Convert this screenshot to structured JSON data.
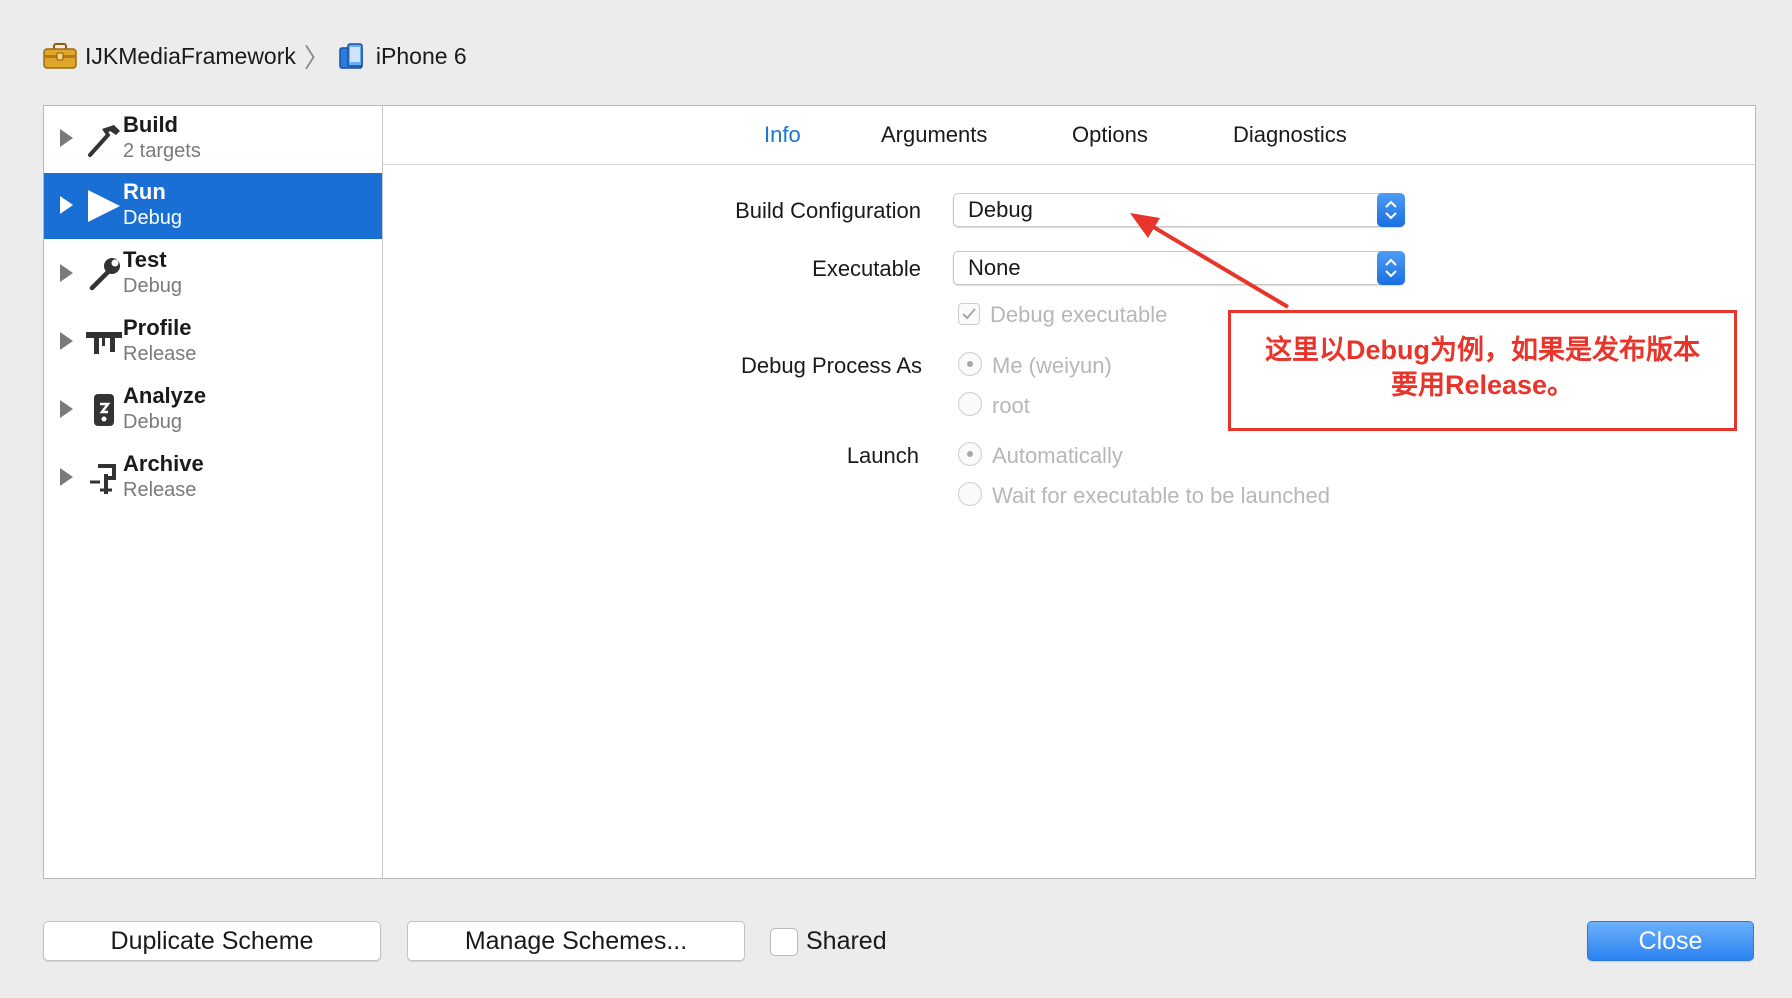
{
  "breadcrumb": {
    "project": "IJKMediaFramework",
    "project_icon": "toolbox-icon",
    "separator": "〉",
    "device": "iPhone 6",
    "device_icon": "device-icon"
  },
  "sidebar": {
    "items": [
      {
        "title": "Build",
        "subtitle": "2 targets",
        "icon": "hammer-icon",
        "selected": false
      },
      {
        "title": "Run",
        "subtitle": "Debug",
        "icon": "play-icon",
        "selected": true
      },
      {
        "title": "Test",
        "subtitle": "Debug",
        "icon": "wrench-icon",
        "selected": false
      },
      {
        "title": "Profile",
        "subtitle": "Release",
        "icon": "caliper-icon",
        "selected": false
      },
      {
        "title": "Analyze",
        "subtitle": "Debug",
        "icon": "analyze-icon",
        "selected": false
      },
      {
        "title": "Archive",
        "subtitle": "Release",
        "icon": "archive-icon",
        "selected": false
      }
    ]
  },
  "tabs": [
    {
      "label": "Info",
      "active": true
    },
    {
      "label": "Arguments",
      "active": false
    },
    {
      "label": "Options",
      "active": false
    },
    {
      "label": "Diagnostics",
      "active": false
    }
  ],
  "form": {
    "build_configuration_label": "Build Configuration",
    "build_configuration_value": "Debug",
    "executable_label": "Executable",
    "executable_value": "None",
    "debug_executable_label": "Debug executable",
    "debug_executable_checked": true,
    "debug_process_as_label": "Debug Process As",
    "debug_process_options": [
      "Me (weiyun)",
      "root"
    ],
    "debug_process_selected": "Me (weiyun)",
    "launch_label": "Launch",
    "launch_options": [
      "Automatically",
      "Wait for executable to be launched"
    ],
    "launch_selected": "Automatically"
  },
  "annotation": {
    "line1": "这里以Debug为例，如果是发布版本",
    "line2": "要用Release。",
    "color": "#e8342a"
  },
  "footer": {
    "duplicate_label": "Duplicate Scheme",
    "manage_label": "Manage Schemes...",
    "shared_label": "Shared",
    "shared_checked": false,
    "close_label": "Close"
  },
  "colors": {
    "accent": "#1a6fd4",
    "tab_active": "#1a76d2",
    "disabled_text": "#b7b7b7"
  }
}
